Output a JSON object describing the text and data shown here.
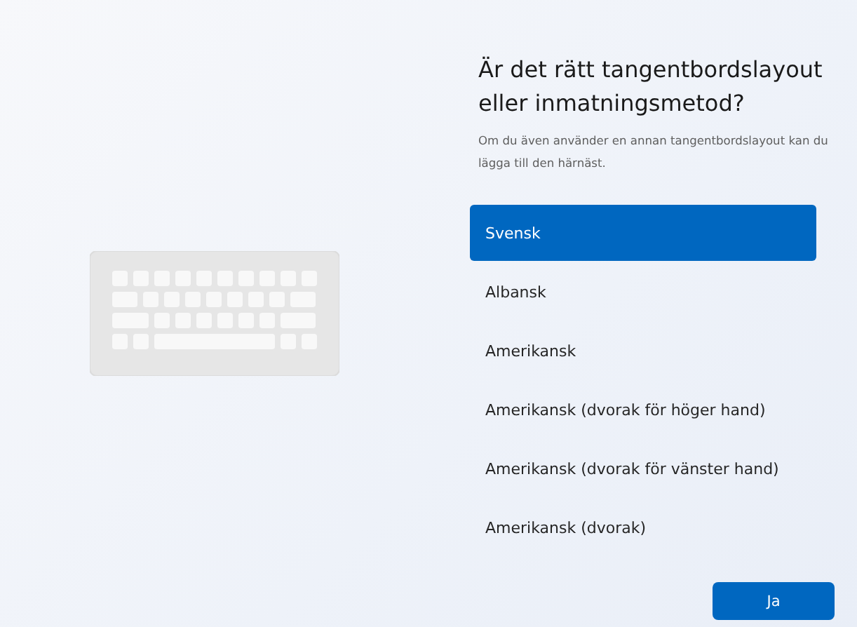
{
  "title": "Är det rätt tangentbordslayout eller inmatningsmetod?",
  "subtitle": "Om du även använder en annan tangentbordslayout kan du lägga till den härnäst.",
  "layouts": [
    {
      "label": "Svensk",
      "selected": true
    },
    {
      "label": "Albansk",
      "selected": false
    },
    {
      "label": "Amerikansk",
      "selected": false
    },
    {
      "label": "Amerikansk (dvorak för höger hand)",
      "selected": false
    },
    {
      "label": "Amerikansk (dvorak för vänster hand)",
      "selected": false
    },
    {
      "label": "Amerikansk (dvorak)",
      "selected": false
    }
  ],
  "buttons": [
    "Ja"
  ]
}
